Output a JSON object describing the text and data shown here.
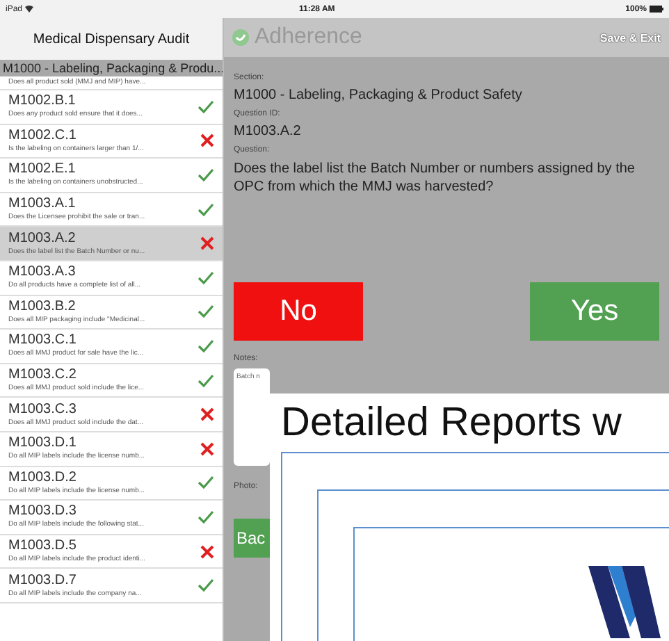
{
  "status_bar": {
    "carrier": "iPad",
    "time": "11:28 AM",
    "battery": "100%"
  },
  "sidebar": {
    "title": "Medical Dispensary Audit",
    "section": "M1000 - Labeling, Packaging & Produ...",
    "top_item_subtitle": "Does all product sold (MMJ and MIP) have...",
    "items": [
      {
        "id": "M1002.B.1",
        "subtitle": "Does any product sold ensure that it does...",
        "kind": "check",
        "selected": false
      },
      {
        "id": "M1002.C.1",
        "subtitle": "Is the labeling on containers larger than 1/...",
        "kind": "cross",
        "selected": false
      },
      {
        "id": "M1002.E.1",
        "subtitle": "Is the labeling on containers unobstructed...",
        "kind": "check",
        "selected": false
      },
      {
        "id": "M1003.A.1",
        "subtitle": "Does the Licensee prohibit the sale or tran...",
        "kind": "check",
        "selected": false
      },
      {
        "id": "M1003.A.2",
        "subtitle": "Does the label list the Batch Number or nu...",
        "kind": "cross",
        "selected": true
      },
      {
        "id": "M1003.A.3",
        "subtitle": "Do all products have a complete list of all...",
        "kind": "check",
        "selected": false
      },
      {
        "id": "M1003.B.2",
        "subtitle": "Does all MIP packaging include \"Medicinal...",
        "kind": "check",
        "selected": false
      },
      {
        "id": "M1003.C.1",
        "subtitle": "Does all MMJ product for sale have the lic...",
        "kind": "check",
        "selected": false
      },
      {
        "id": "M1003.C.2",
        "subtitle": "Does all MMJ product sold include the lice...",
        "kind": "check",
        "selected": false
      },
      {
        "id": "M1003.C.3",
        "subtitle": "Does all MMJ product sold include the dat...",
        "kind": "cross",
        "selected": false
      },
      {
        "id": "M1003.D.1",
        "subtitle": "Do all MIP labels include the license numb...",
        "kind": "cross",
        "selected": false
      },
      {
        "id": "M1003.D.2",
        "subtitle": "Do all MIP labels include the license numb...",
        "kind": "check",
        "selected": false
      },
      {
        "id": "M1003.D.3",
        "subtitle": "Do all MIP labels include the following stat...",
        "kind": "check",
        "selected": false
      },
      {
        "id": "M1003.D.5",
        "subtitle": "Do all MIP labels include the product identi...",
        "kind": "cross",
        "selected": false
      },
      {
        "id": "M1003.D.7",
        "subtitle": "Do all MIP labels include the company na...",
        "kind": "check",
        "selected": false
      }
    ]
  },
  "main": {
    "app_name": "Adherence",
    "save_button": "Save & Exit",
    "section_label": "Section:",
    "section": "M1000 - Labeling, Packaging & Product Safety",
    "question_id_label": "Question ID:",
    "question_id": "M1003.A.2",
    "question_label": "Question:",
    "question": "Does the label list the Batch Number or numbers assigned by the OPC from which the MMJ was harvested?",
    "no_button": "No",
    "yes_button": "Yes",
    "notes_label": "Notes:",
    "notes_value": "Batch n",
    "photo_label": "Photo:",
    "back_button": "Bac"
  },
  "overlay": {
    "heading": "Detailed Reports w"
  }
}
